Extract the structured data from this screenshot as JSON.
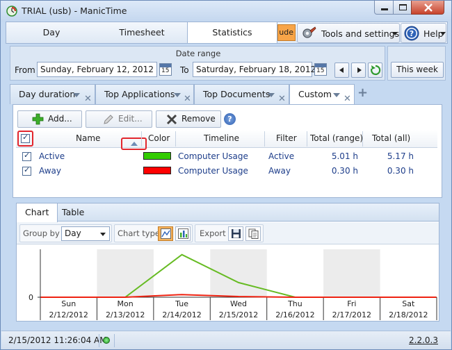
{
  "window": {
    "title": "TRIAL (usb) - ManicTime"
  },
  "main_tabs": [
    {
      "label": "Day"
    },
    {
      "label": "Timesheet"
    },
    {
      "label": "Statistics"
    }
  ],
  "mode_badge": "ude",
  "tools_label": "Tools and settings",
  "help_label": "Help",
  "date_range": {
    "title": "Date range",
    "from_label": "From",
    "from_value": "Sunday, February 12, 2012",
    "to_label": "To",
    "to_value": "Saturday, February 18, 2012",
    "calendar_day": "15",
    "this_week_label": "This week"
  },
  "sub_tabs": [
    {
      "label": "Day duration"
    },
    {
      "label": "Top Applications"
    },
    {
      "label": "Top Documents"
    },
    {
      "label": "Custom"
    }
  ],
  "toolbar": {
    "add_label": "Add...",
    "edit_label": "Edit...",
    "remove_label": "Remove"
  },
  "grid": {
    "headers": {
      "name": "Name",
      "color": "Color",
      "timeline": "Timeline",
      "filter": "Filter",
      "total_range": "Total (range)",
      "total_all": "Total (all)"
    },
    "rows": [
      {
        "name": "Active",
        "color": "#33cc00",
        "timeline": "Computer Usage",
        "filter": "Active",
        "total_range": "5.01 h",
        "total_all": "5.17 h"
      },
      {
        "name": "Away",
        "color": "#ff0000",
        "timeline": "Computer Usage",
        "filter": "Away",
        "total_range": "0.30 h",
        "total_all": "0.30 h"
      }
    ]
  },
  "chart_tabs": [
    {
      "label": "Chart"
    },
    {
      "label": "Table"
    }
  ],
  "chart_toolbar": {
    "group_by_label": "Group by",
    "group_by_value": "Day",
    "chart_type_label": "Chart type",
    "export_label": "Export"
  },
  "chart_data": {
    "type": "line",
    "categories": [
      {
        "day": "Sun",
        "date": "2/12/2012"
      },
      {
        "day": "Mon",
        "date": "2/13/2012"
      },
      {
        "day": "Tue",
        "date": "2/14/2012"
      },
      {
        "day": "Wed",
        "date": "2/15/2012"
      },
      {
        "day": "Thu",
        "date": "2/16/2012"
      },
      {
        "day": "Fri",
        "date": "2/17/2012"
      },
      {
        "day": "Sat",
        "date": "2/18/2012"
      }
    ],
    "y_tick_label": "0",
    "series": [
      {
        "color": "#66bb22",
        "values": [
          0,
          0,
          3.2,
          1.1,
          0,
          0,
          0
        ]
      },
      {
        "color": "#ee2211",
        "values": [
          0,
          0,
          0.2,
          0.05,
          0,
          0,
          0
        ]
      }
    ],
    "ylim": [
      0,
      3.6
    ]
  },
  "status": {
    "datetime": "2/15/2012 11:26:04 AM",
    "version": "2.2.0.3"
  }
}
